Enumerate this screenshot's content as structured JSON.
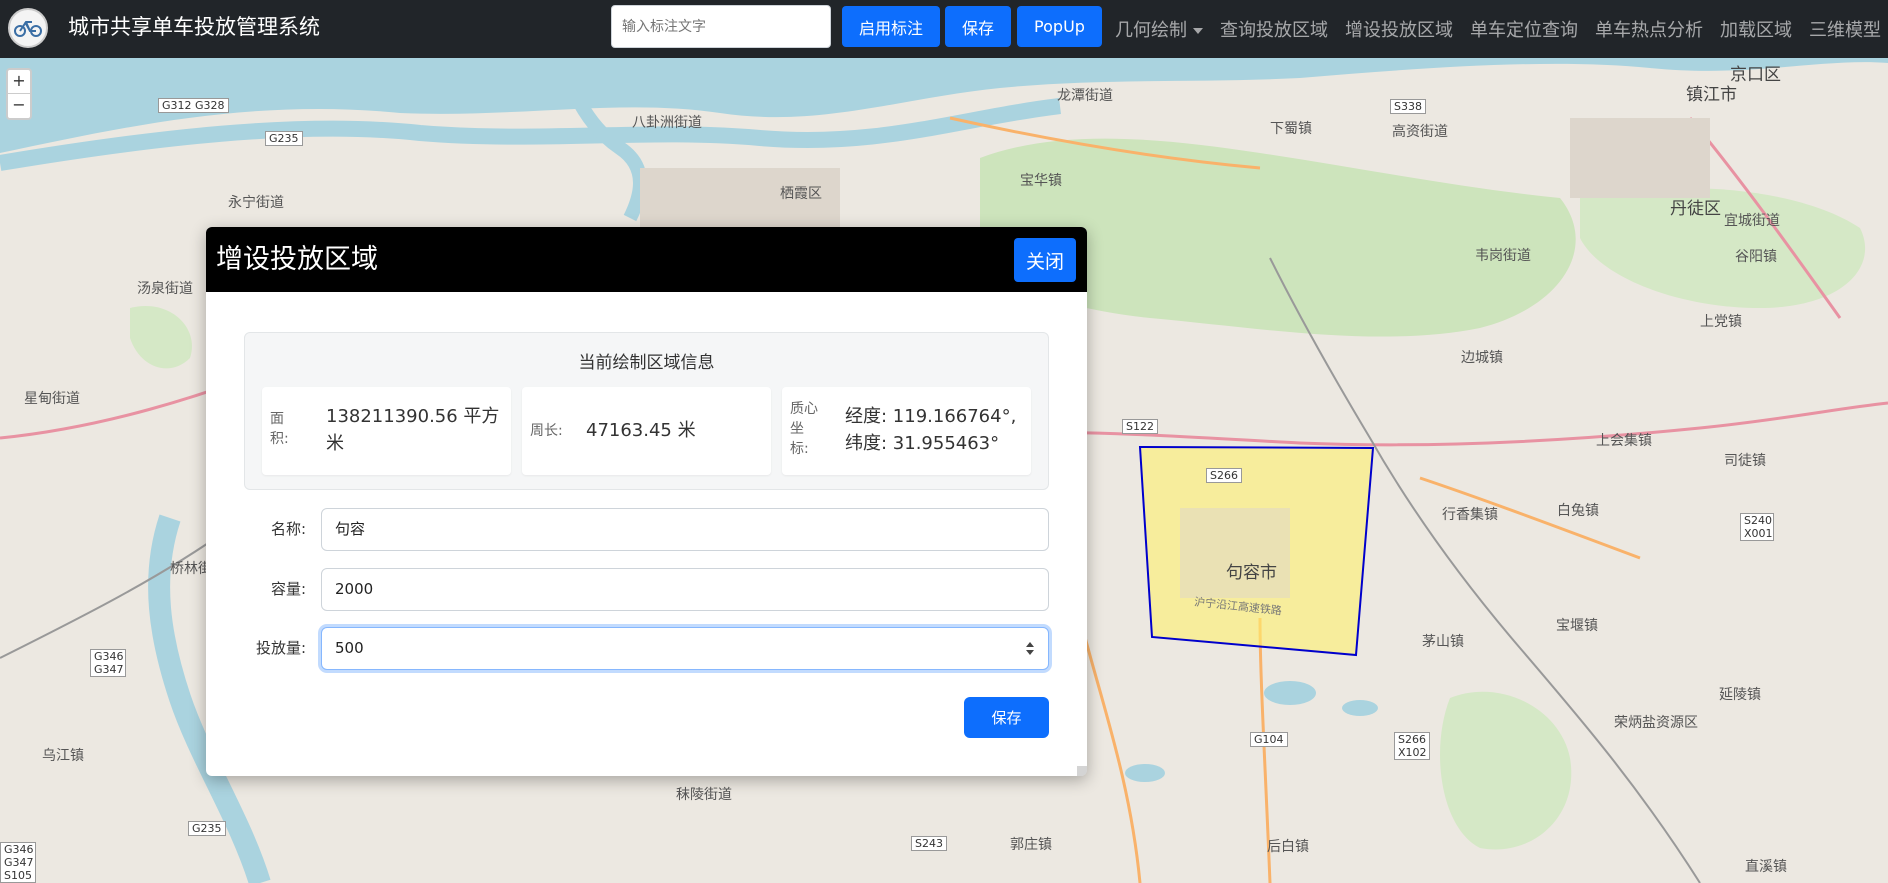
{
  "app": {
    "title": "城市共享单车投放管理系统",
    "logo_icon": "bicycle-icon"
  },
  "toolbar": {
    "search_placeholder": "输入标注文字",
    "enable_label": "启用标注",
    "save_label": "保存",
    "popup_label": "PopUp"
  },
  "nav": {
    "items": [
      {
        "label": "几何绘制",
        "dropdown": true
      },
      {
        "label": "查询投放区域"
      },
      {
        "label": "增设投放区域"
      },
      {
        "label": "单车定位查询"
      },
      {
        "label": "单车热点分析"
      },
      {
        "label": "加载区域"
      },
      {
        "label": "三维模型"
      }
    ]
  },
  "map": {
    "zoom_in": "+",
    "zoom_out": "−",
    "labels": [
      "镇江市",
      "京口区",
      "丹徒区",
      "宜城街道",
      "谷阳镇",
      "上党镇",
      "高资街道",
      "下蜀镇",
      "龙潭街道",
      "宝华镇",
      "韦岗街道",
      "边城镇",
      "白兔镇",
      "上会集镇",
      "司徒镇",
      "行香集镇",
      "茅山镇",
      "宝堰镇",
      "延陵镇",
      "荣炳盐资源区",
      "八卦洲街道",
      "永宁街道",
      "汤泉街道",
      "星甸街道",
      "桥林街",
      "乌江镇",
      "栖霞区",
      "句容市",
      "后白镇",
      "郭庄镇",
      "秣陵街道",
      "直溪镇",
      "丹徒区",
      "沪宁沿江高速铁路"
    ],
    "shields": [
      "G312 G328",
      "G235",
      "S338",
      "S122",
      "S266",
      "S240 X001",
      "G346 G347",
      "G104",
      "S266 X102",
      "G235",
      "S243",
      "G346 G347 S105"
    ],
    "polygon_fill": "#fff06e",
    "polygon_stroke": "#0000cc"
  },
  "modal": {
    "title": "增设投放区域",
    "close_label": "关闭",
    "info_title": "当前绘制区域信息",
    "area_label": "面积:",
    "area_value": "138211390.56 平方米",
    "perimeter_label": "周长:",
    "perimeter_value": "47163.45 米",
    "centroid_label": "质心坐标:",
    "centroid_value": "经度: 119.166764°, 纬度: 31.955463°",
    "name_label": "名称:",
    "name_value": "句容",
    "capacity_label": "容量:",
    "capacity_value": "2000",
    "amount_label": "投放量:",
    "amount_value": "500",
    "save_label": "保存"
  }
}
